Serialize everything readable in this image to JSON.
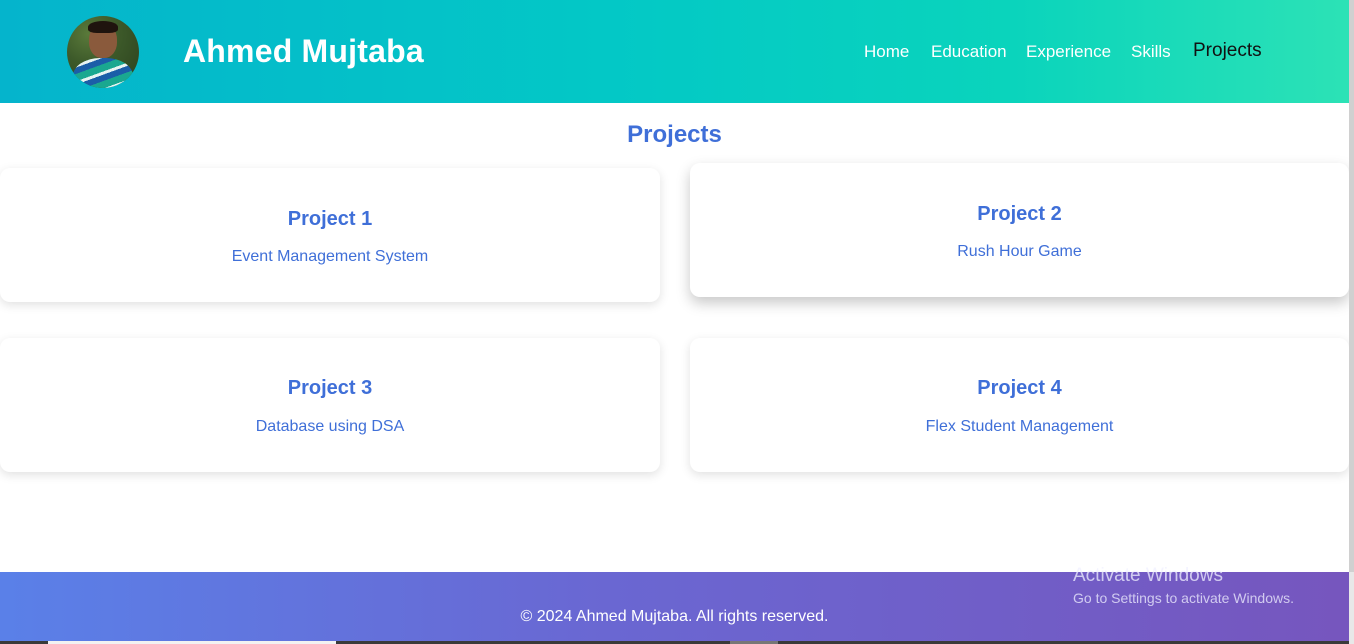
{
  "header": {
    "brand": "Ahmed Mujtaba",
    "nav": [
      {
        "label": "Home",
        "active": false
      },
      {
        "label": "Education",
        "active": false
      },
      {
        "label": "Experience",
        "active": false
      },
      {
        "label": "Skills",
        "active": false
      },
      {
        "label": "Projects",
        "active": true
      }
    ]
  },
  "projects": {
    "title": "Projects",
    "cards": [
      {
        "title": "Project 1",
        "description": "Event Management System"
      },
      {
        "title": "Project 2",
        "description": "Rush Hour Game"
      },
      {
        "title": "Project 3",
        "description": "Database using DSA"
      },
      {
        "title": "Project 4",
        "description": "Flex Student Management"
      }
    ]
  },
  "footer": {
    "copyright": "© 2024 Ahmed Mujtaba. All rights reserved."
  },
  "watermark": {
    "line1": "Activate Windows",
    "line2": "Go to Settings to activate Windows."
  },
  "colors": {
    "header_gradient_start": "#05b4cc",
    "header_gradient_end": "#2ce2b6",
    "accent": "#3f6fd8",
    "footer_gradient_start": "#5a80e8",
    "footer_gradient_end": "#7656be"
  }
}
